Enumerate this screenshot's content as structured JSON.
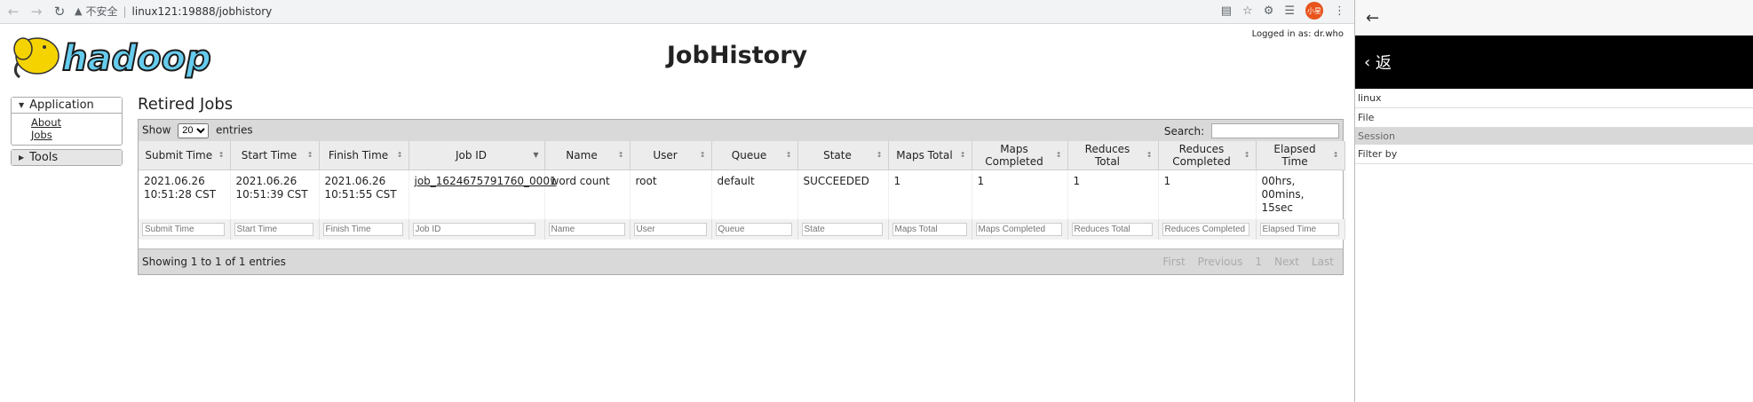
{
  "browser": {
    "security": "不安全",
    "url": "linux121:19888/jobhistory",
    "avatar_text": "小星"
  },
  "header": {
    "logo_text": "hadoop",
    "title": "JobHistory",
    "logged_in": "Logged in as: dr.who"
  },
  "sidebar": {
    "application_label": "Application",
    "links": [
      "About",
      "Jobs"
    ],
    "tools_label": "Tools"
  },
  "main": {
    "section_title": "Retired Jobs",
    "show_label": "Show",
    "entries_label": "entries",
    "page_size": "20",
    "search_label": "Search:",
    "columns": [
      "Submit Time",
      "Start Time",
      "Finish Time",
      "Job ID",
      "Name",
      "User",
      "Queue",
      "State",
      "Maps Total",
      "Maps Completed",
      "Reduces Total",
      "Reduces Completed",
      "Elapsed Time"
    ],
    "rows": [
      [
        "2021.06.26 10:51:28 CST",
        "2021.06.26 10:51:39 CST",
        "2021.06.26 10:51:55 CST",
        "job_1624675791760_0001",
        "word count",
        "root",
        "default",
        "SUCCEEDED",
        "1",
        "1",
        "1",
        "1",
        "00hrs, 00mins, 15sec"
      ]
    ],
    "info": "Showing 1 to 1 of 1 entries",
    "pager": [
      "First",
      "Previous",
      "1",
      "Next",
      "Last"
    ]
  },
  "side_window": {
    "top": "返",
    "items": [
      "linux",
      "File",
      "Session",
      "Filter by"
    ]
  }
}
